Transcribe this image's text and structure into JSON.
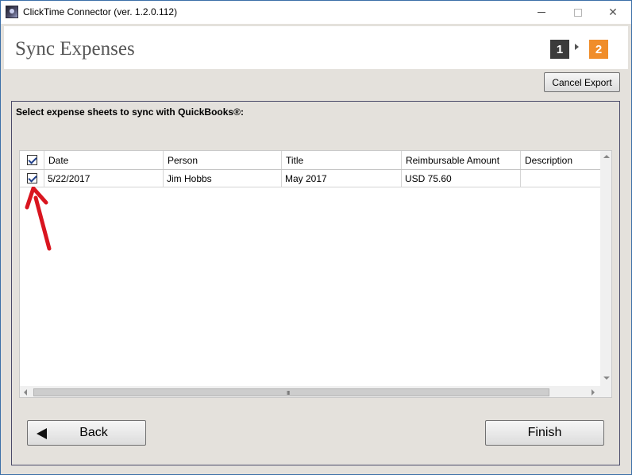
{
  "window": {
    "title": "ClickTime Connector (ver. 1.2.0.112)",
    "controls": {
      "minimize_icon": "minimize-icon",
      "maximize_icon": "maximize-icon",
      "close_icon": "close-icon",
      "close_glyph": "✕"
    }
  },
  "header": {
    "title": "Sync Expenses",
    "steps": [
      "1",
      "2"
    ],
    "active_step": "2",
    "colors": {
      "step_inactive": "#3b3b3b",
      "step_active": "#f08d2a"
    }
  },
  "toolbar": {
    "cancel_label": "Cancel Export"
  },
  "panel": {
    "instructions": "Select expense sheets to sync with QuickBooks®:",
    "grid": {
      "columns": [
        "Date",
        "Person",
        "Title",
        "Reimbursable Amount",
        "Description"
      ],
      "header_checked": true,
      "rows": [
        {
          "checked": true,
          "date": "5/22/2017",
          "person": "Jim Hobbs",
          "title": "May 2017",
          "amount": "USD 75.60",
          "description": ""
        }
      ]
    },
    "scrollbar_grip": "III"
  },
  "footer": {
    "back_label": "Back",
    "finish_label": "Finish"
  },
  "annotation": {
    "arrow_color": "#d9151f"
  }
}
